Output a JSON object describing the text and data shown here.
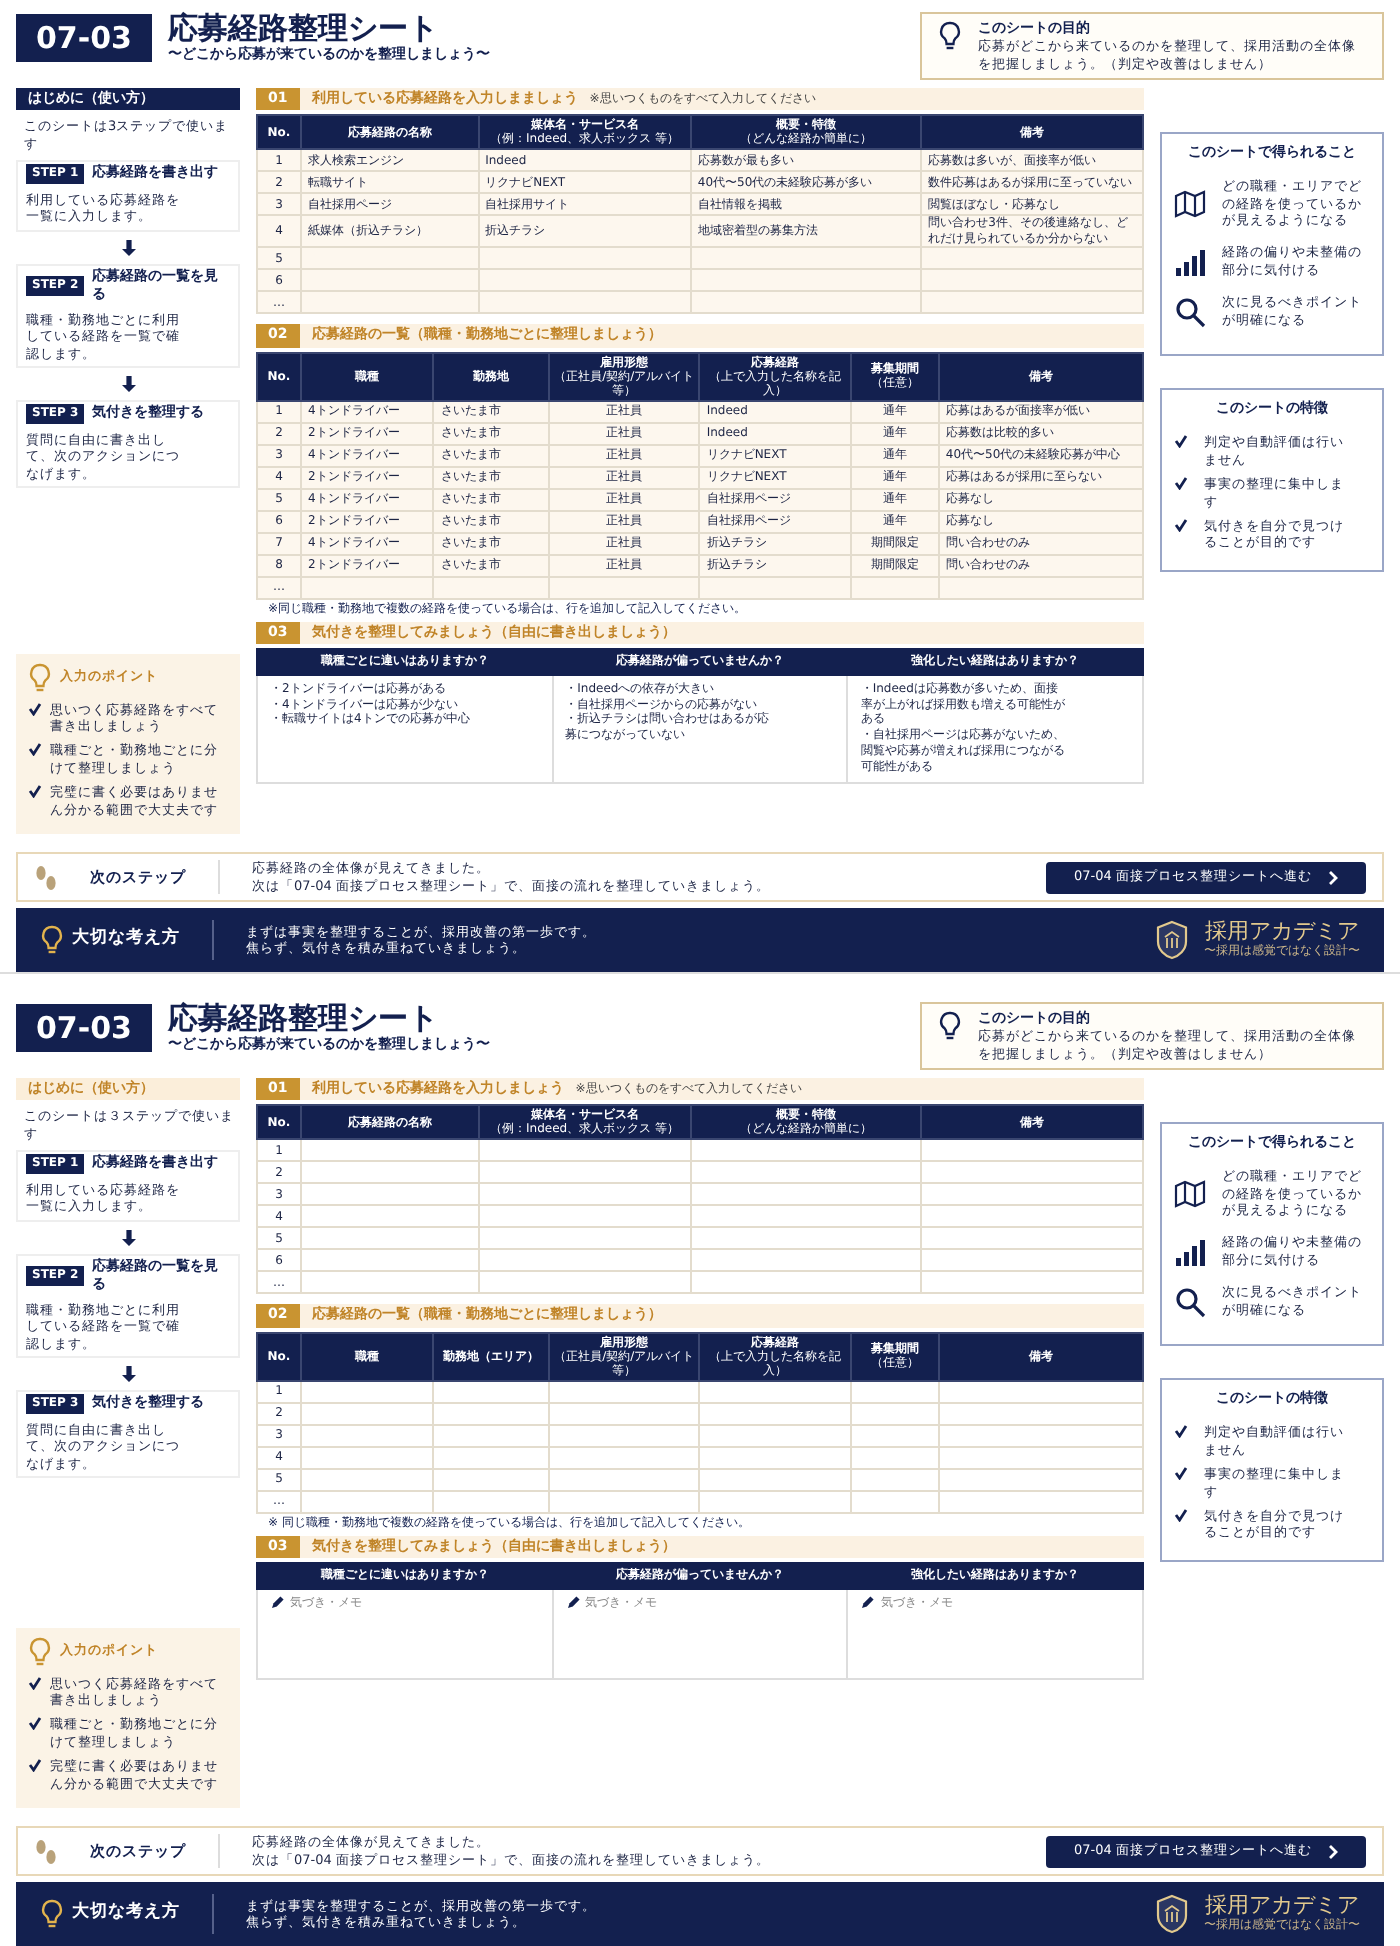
{
  "pages": [
    {
      "badge": "07-03",
      "title": "応募経路整理シート",
      "subtitle": "〜どこから応募が来ているのかを整理しましょう〜",
      "purpose": {
        "title": "このシートの目的",
        "text": "応募がどこから来ているのかを整理して、採用活動の全体像を把握しましょう。（判定や改善はしません）"
      },
      "intro": {
        "heading": "はじめに（使い方）",
        "lead": "このシートは3ステップで使います",
        "steps": [
          {
            "label": "STEP 1",
            "title": "応募経路を書き出す",
            "text": "利用している応募経路を一覧に入力します。"
          },
          {
            "label": "STEP 2",
            "title": "応募経路の一覧を見る",
            "text": "職種・勤務地ごとに利用している経路を一覧で確認します。"
          },
          {
            "label": "STEP 3",
            "title": "気付きを整理する",
            "text": "質問に自由に書き出して、次のアクションにつなげます。"
          }
        ]
      },
      "points": {
        "title": "入力のポイント",
        "items": [
          "思いつく応募経路をすべて書き出しましょう",
          "職種ごと・勤務地ごとに分けて整理しましょう",
          "完璧に書く必要はありません分かる範囲で大丈夫です"
        ]
      },
      "routes": {
        "number": "01",
        "title": "利用している応募経路を入力しまましょう",
        "note": "※思いつくものをすべて入力してください",
        "columns": [
          {
            "label": "No."
          },
          {
            "label": "応募経路の名称"
          },
          {
            "label": "媒体名・サービス名",
            "sub": "（例：Indeed、求人ボックス 等）"
          },
          {
            "label": "概要・特徴",
            "sub": "（どんな経路か簡単に）"
          },
          {
            "label": "備考"
          }
        ],
        "rows": [
          {
            "no": "1",
            "cells": [
              "求人検索エンジン",
              "Indeed",
              "応募数が最も多い",
              "応募数は多いが、面接率が低い"
            ]
          },
          {
            "no": "2",
            "cells": [
              "転職サイト",
              "リクナビNEXT",
              "40代〜50代の未経験応募が多い",
              "数件応募はあるが採用に至っていない"
            ]
          },
          {
            "no": "3",
            "cells": [
              "自社採用ページ",
              "自社採用サイト",
              "自社情報を掲載",
              "閲覧ほぼなし・応募なし"
            ]
          },
          {
            "no": "4",
            "cells": [
              "紙媒体（折込チラシ）",
              "折込チラシ",
              "地域密着型の募集方法",
              "問い合わせ3件、その後連絡なし、どれだけ見られているか分からない"
            ]
          },
          {
            "no": "5"
          },
          {
            "no": "6"
          },
          {
            "no": "…"
          }
        ]
      },
      "breakdown": {
        "number": "02",
        "title": "応募経路の一覧（職種・勤務地ごとに整理しましょう）",
        "footnote": "※同じ職種・勤務地で複数の経路を使っている場合は、行を追加して記入してください。",
        "columns": [
          {
            "label": "No."
          },
          {
            "label": "職種"
          },
          {
            "label": "勤務地"
          },
          {
            "label": "雇用形態",
            "sub": "（正社員/契約/アルバイト等）"
          },
          {
            "label": "応募経路",
            "sub": "（上で入力した名称を記入）"
          },
          {
            "label": "募集期間",
            "sub": "（任意）"
          },
          {
            "label": "備考"
          }
        ],
        "rows": [
          {
            "no": "1",
            "cells": [
              "4トンドライバー",
              "さいたま市",
              "正社員",
              "Indeed",
              "通年",
              "応募はあるが面接率が低い"
            ]
          },
          {
            "no": "2",
            "cells": [
              "2トンドライバー",
              "さいたま市",
              "正社員",
              "Indeed",
              "通年",
              "応募数は比較的多い"
            ]
          },
          {
            "no": "3",
            "cells": [
              "4トンドライバー",
              "さいたま市",
              "正社員",
              "リクナビNEXT",
              "通年",
              "40代〜50代の未経験応募が中心"
            ]
          },
          {
            "no": "4",
            "cells": [
              "2トンドライバー",
              "さいたま市",
              "正社員",
              "リクナビNEXT",
              "通年",
              "応募はあるが採用に至らない"
            ]
          },
          {
            "no": "5",
            "cells": [
              "4トンドライバー",
              "さいたま市",
              "正社員",
              "自社採用ページ",
              "通年",
              "応募なし"
            ]
          },
          {
            "no": "6",
            "cells": [
              "2トンドライバー",
              "さいたま市",
              "正社員",
              "自社採用ページ",
              "通年",
              "応募なし"
            ]
          },
          {
            "no": "7",
            "cells": [
              "4トンドライバー",
              "さいたま市",
              "正社員",
              "折込チラシ",
              "期間限定",
              "問い合わせのみ"
            ]
          },
          {
            "no": "8",
            "cells": [
              "2トンドライバー",
              "さいたま市",
              "正社員",
              "折込チラシ",
              "期間限定",
              "問い合わせのみ"
            ]
          },
          {
            "no": "…"
          }
        ]
      },
      "insights": {
        "number": "03",
        "title": "気付きを整理してみましょう（自由に書き出しましょう）",
        "questions": [
          {
            "heading": "職種ごとに違いはありますか？",
            "answers": [
              "・2トンドライバーは応募がある",
              "・4トンドライバーは応募が少ない",
              "・転職サイトは4トンでの応募が中心"
            ]
          },
          {
            "heading": "応募経路が偏っていませんか？",
            "answers": [
              "・Indeedへの依存が大きい",
              "・自社採用ページからの応募がない",
              "・折込チラシは問い合わせはあるが応募につながっていない"
            ]
          },
          {
            "heading": "強化したい経路はありますか？",
            "answers": [
              "・Indeedは応募数が多いため、面接率が上がれば採用数も増える可能性がある",
              "・自社採用ページは応募がないため、閲覧や応募が増えれば採用につながる可能性がある"
            ]
          }
        ]
      },
      "gains": {
        "title": "このシートで得られること",
        "items": [
          "どの職種・エリアでどの経路を使っているかが見えるようになる",
          "経路の偏りや未整備の部分に気付ける",
          "次に見るべきポイントが明確になる"
        ]
      },
      "features": {
        "title": "このシートの特徴",
        "items": [
          "判定や自動評価は行いません",
          "事実の整理に集中します",
          "気付きを自分で見つけることが目的です"
        ]
      },
      "next": {
        "label": "次のステップ",
        "lines": [
          "応募経路の全体像が見えてきました。",
          "次は「07-04 面接プロセス整理シート」で、面接の流れを整理していきましょう。"
        ],
        "button": "07-04 面接プロセス整理シートへ進む"
      },
      "footer": {
        "label": "大切な考え方",
        "lines": [
          "まずは事実を整理することが、採用改善の第一歩です。",
          "焦らず、気付きを積み重ねていきましょう。"
        ],
        "brand": "採用アカデミア",
        "tagline": "〜採用は感覚ではなく設計〜"
      }
    },
    {
      "badge": "07-03",
      "title": "応募経路整理シート",
      "subtitle": "〜どこから応募が来ているのかを整理しましょう〜",
      "purpose": {
        "title": "このシートの目的",
        "text": "応募がどこから来ているのかを整理して、採用活動の全体像を把握しましょう。（判定や改善はしません）"
      },
      "intro": {
        "heading": "はじめに（使い方）",
        "lead": "このシートは３ステップで使います",
        "steps": [
          {
            "label": "STEP 1",
            "title": "応募経路を書き出す",
            "text": "利用している応募経路を一覧に入力します。"
          },
          {
            "label": "STEP 2",
            "title": "応募経路の一覧を見る",
            "text": "職種・勤務地ごとに利用している経路を一覧で確認します。"
          },
          {
            "label": "STEP 3",
            "title": "気付きを整理する",
            "text": "質問に自由に書き出して、次のアクションにつなげます。"
          }
        ]
      },
      "points": {
        "title": "入力のポイント",
        "items": [
          "思いつく応募経路をすべて書き出しましょう",
          "職種ごと・勤務地ごとに分けて整理しましょう",
          "完璧に書く必要はありません分かる範囲で大丈夫です"
        ]
      },
      "routes": {
        "number": "01",
        "title": "利用している応募経路を入力しましょう",
        "note": "※思いつくものをすべて入力してください",
        "columns": [
          {
            "label": "No."
          },
          {
            "label": "応募経路の名称"
          },
          {
            "label": "媒体名・サービス名",
            "sub": "（例：Indeed、求人ボックス 等）"
          },
          {
            "label": "概要・特徴",
            "sub": "（どんな経路か簡単に）"
          },
          {
            "label": "備考"
          }
        ],
        "rows": [
          {
            "no": "1"
          },
          {
            "no": "2"
          },
          {
            "no": "3"
          },
          {
            "no": "4"
          },
          {
            "no": "5"
          },
          {
            "no": "6"
          },
          {
            "no": "…"
          }
        ]
      },
      "breakdown": {
        "number": "02",
        "title": "応募経路の一覧（職種・勤務地ごとに整理しましょう）",
        "footnote": "※ 同じ職種・勤務地で複数の経路を使っている場合は、行を追加して記入してください。",
        "columns": [
          {
            "label": "No."
          },
          {
            "label": "職種"
          },
          {
            "label": "勤務地（エリア）"
          },
          {
            "label": "雇用形態",
            "sub": "（正社員/契約/アルバイト等）"
          },
          {
            "label": "応募経路",
            "sub": "（上で入力した名称を記入）"
          },
          {
            "label": "募集期間",
            "sub": "（任意）"
          },
          {
            "label": "備考"
          }
        ],
        "rows": [
          {
            "no": "1"
          },
          {
            "no": "2"
          },
          {
            "no": "3"
          },
          {
            "no": "4"
          },
          {
            "no": "5"
          },
          {
            "no": "…"
          }
        ]
      },
      "insights": {
        "number": "03",
        "title": "気付きを整理してみましょう（自由に書き出しましょう）",
        "questions": [
          {
            "heading": "職種ごとに違いはありますか？",
            "placeholder": "気づき・メモ"
          },
          {
            "heading": "応募経路が偏っていませんか？",
            "placeholder": "気づき・メモ"
          },
          {
            "heading": "強化したい経路はありますか？",
            "placeholder": "気づき・メモ"
          }
        ]
      },
      "gains": {
        "title": "このシートで得られること",
        "items": [
          "どの職種・エリアでどの経路を使っているかが見えるようになる",
          "経路の偏りや未整備の部分に気付ける",
          "次に見るべきポイントが明確になる"
        ]
      },
      "features": {
        "title": "このシートの特徴",
        "items": [
          "判定や自動評価は行いません",
          "事実の整理に集中します",
          "気付きを自分で見つけることが目的です"
        ]
      },
      "next": {
        "label": "次のステップ",
        "lines": [
          "応募経路の全体像が見えてきました。",
          "次は「07-04 面接プロセス整理シート」で、面接の流れを整理していきましょう。"
        ],
        "button": "07-04 面接プロセス整理シートへ進む"
      },
      "footer": {
        "label": "大切な考え方",
        "lines": [
          "まずは事実を整理することが、採用改善の第一歩です。",
          "焦らず、気付きを積み重ねていきましょう。"
        ],
        "brand": "採用アカデミア",
        "tagline": "〜採用は感覚ではなく設計〜"
      }
    }
  ]
}
